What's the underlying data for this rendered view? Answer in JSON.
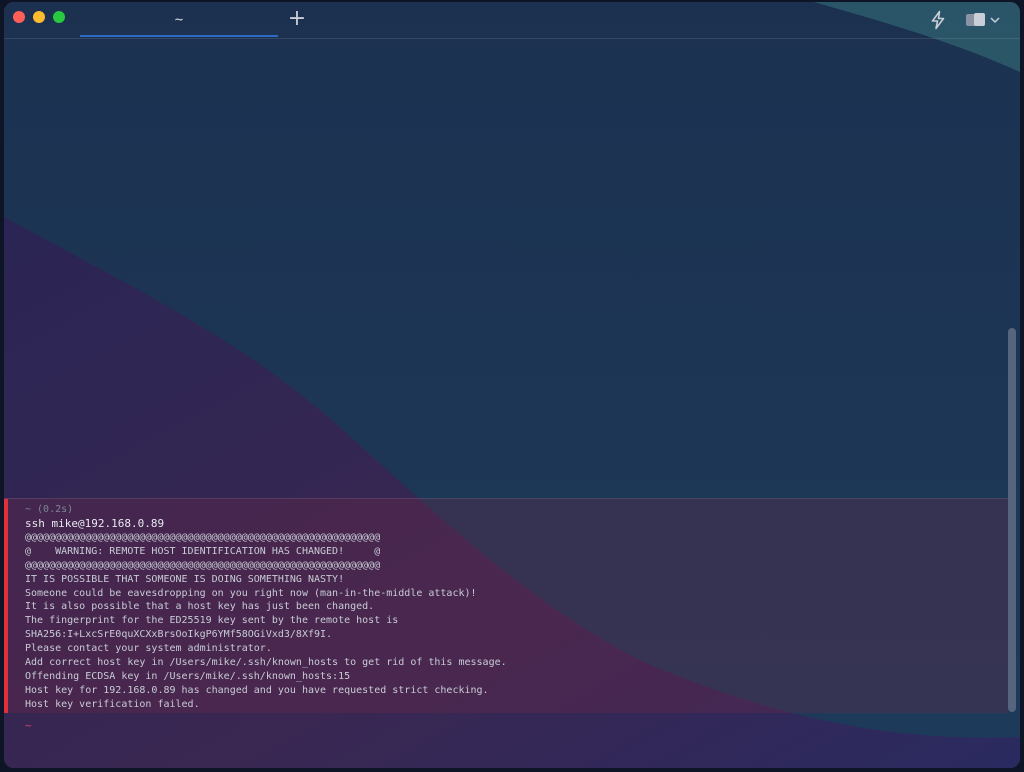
{
  "tab": {
    "title": "~"
  },
  "block": {
    "meta": "~ (0.2s)",
    "command": "ssh mike@192.168.0.89",
    "output": [
      "@@@@@@@@@@@@@@@@@@@@@@@@@@@@@@@@@@@@@@@@@@@@@@@@@@@@@@@@@@@",
      "@    WARNING: REMOTE HOST IDENTIFICATION HAS CHANGED!     @",
      "@@@@@@@@@@@@@@@@@@@@@@@@@@@@@@@@@@@@@@@@@@@@@@@@@@@@@@@@@@@",
      "IT IS POSSIBLE THAT SOMEONE IS DOING SOMETHING NASTY!",
      "Someone could be eavesdropping on you right now (man-in-the-middle attack)!",
      "It is also possible that a host key has just been changed.",
      "The fingerprint for the ED25519 key sent by the remote host is",
      "SHA256:I+LxcSrE0quXCXxBrsOoIkgP6YMf58OGiVxd3/8Xf9I.",
      "Please contact your system administrator.",
      "Add correct host key in /Users/mike/.ssh/known_hosts to get rid of this message.",
      "Offending ECDSA key in /Users/mike/.ssh/known_hosts:15",
      "Host key for 192.168.0.89 has changed and you have requested strict checking.",
      "Host key verification failed."
    ]
  },
  "prompt": {
    "symbol": "~"
  },
  "colors": {
    "error_bar": "#e0303c",
    "tab_underline": "#2c6bc1",
    "prompt": "#d2457b"
  },
  "icons": {
    "close": "close-traffic-light-icon",
    "minimize": "minimize-traffic-light-icon",
    "zoom": "zoom-traffic-light-icon",
    "new_tab": "plus-icon",
    "ai": "lightning-bolt-icon",
    "panes": "split-panes-icon"
  }
}
